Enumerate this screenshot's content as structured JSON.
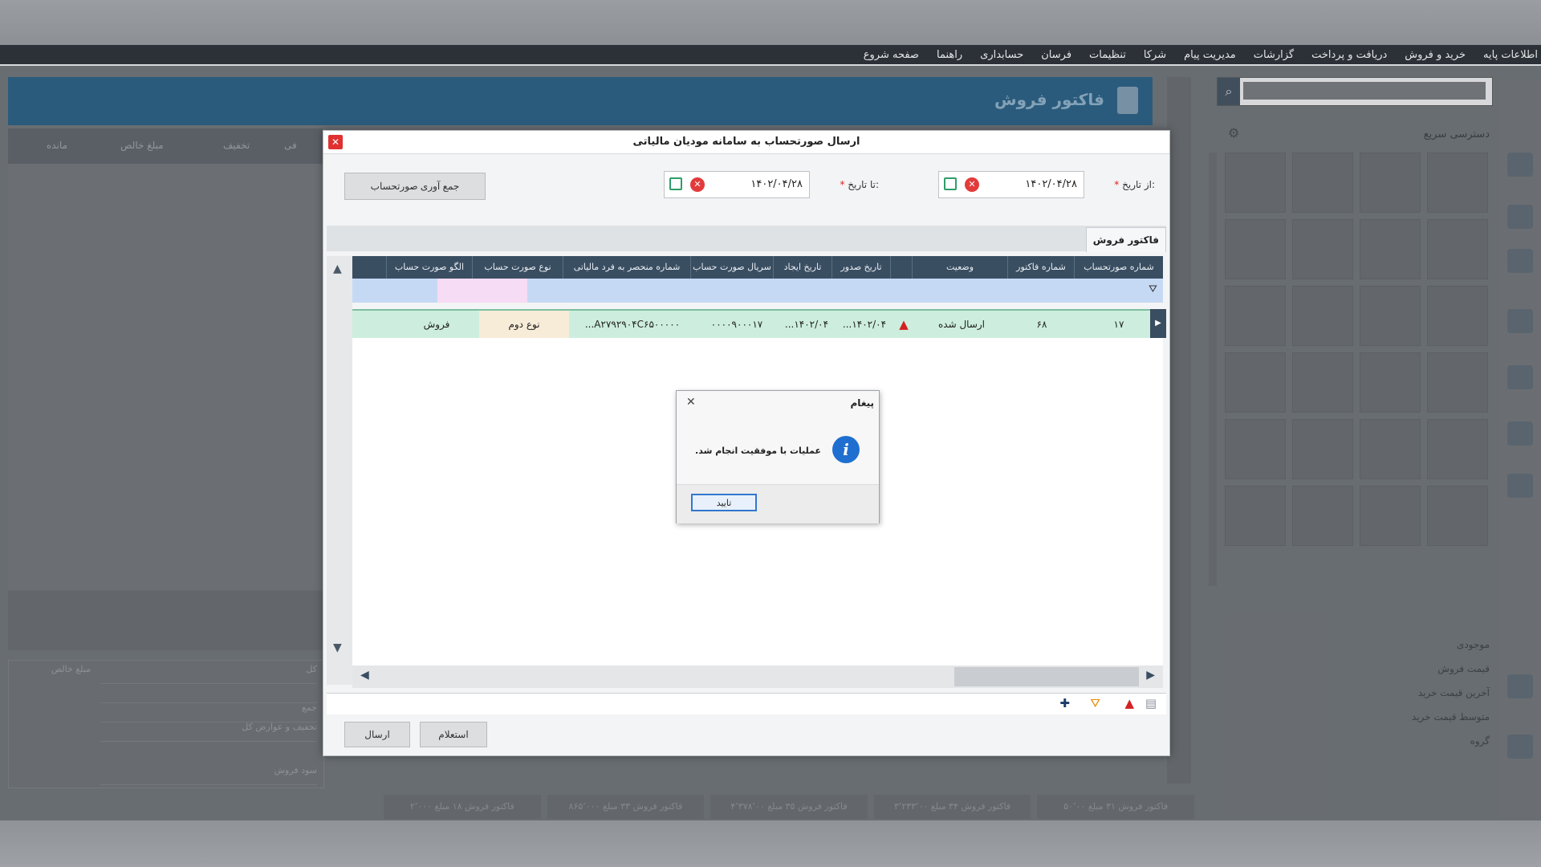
{
  "menu": [
    "اطلاعات پایه",
    "خرید و فروش",
    "دریافت و پرداخت",
    "گزارشات",
    "مدیریت پیام",
    "شرکا",
    "تنظیمات",
    "فرسان",
    "حسابداری",
    "راهنما",
    "صفحه شروع"
  ],
  "main": {
    "title": "فاکتور فروش",
    "columns": [
      "مبلغ خالص",
      "تخفیف",
      "فی",
      "مانده"
    ]
  },
  "left_summary": [
    "کل",
    "",
    "جمع",
    "تخفیف و عوارض کل",
    "سود فروش",
    "مبلغ خالص"
  ],
  "quick_access": {
    "title": "دسترسی سریع",
    "info": [
      "موجودی",
      "قیمت فروش",
      "آخرین قیمت خرید",
      "متوسط قیمت خرید",
      "گروه"
    ]
  },
  "taskbar": [
    "فاکتور فروش ۱۸ مبلغ ۲٬۰۰۰",
    "فاکتور فروش ۳۳ مبلغ ۸۶۵٬۰۰۰",
    "فاکتور فروش ۳۵ مبلغ ۴٬۳۷۸٬۰۰",
    "فاکتور فروش ۳۴ مبلغ ۳٬۲۳۳٬۰۰",
    "فاکتور فروش ۳۱ مبلغ ۵۰٬۰۰"
  ],
  "modal": {
    "title": "ارسال صورتحساب به سامانه مودیان مالیاتی",
    "from_label": "از تاریخ:",
    "from_value": "۱۴۰۲/۰۴/۲۸",
    "to_label": "تا تاریخ:",
    "to_value": "۱۴۰۲/۰۴/۲۸",
    "collect_btn": "جمع آوری صورتحساب",
    "tab": "فاکتور فروش",
    "columns": [
      "شماره صورتحساب",
      "شماره فاکتور",
      "وضعیت",
      "",
      "تاریخ صدور",
      "تاریخ ایجاد",
      "سریال صورت حساب",
      "شماره منحصر به فرد مالیاتی",
      "نوع صورت حساب",
      "الگو صورت حساب"
    ],
    "row": {
      "invoice_no": "۱۷",
      "factor_no": "۶۸",
      "status": "ارسال شده",
      "issue_date": "...۱۴۰۲/۰۴",
      "create_date": "...۱۴۰۲/۰۴",
      "serial": "۰۰۰۰۹۰۰۰۱۷",
      "tax_id": "...A۲۷۹۲۹۰۴C۶۵۰۰۰۰۰",
      "type": "نوع دوم",
      "pattern": "فروش"
    },
    "inquiry_btn": "استعلام",
    "send_btn": "ارسال"
  },
  "message": {
    "title": "پیغام",
    "text": "عملیات با موفقیت انجام شد.",
    "ok": "تایید"
  },
  "colors": {
    "header": "#0d4a73",
    "grid_head": "#3a4e62",
    "row": "#cdeede",
    "close": "#e03131",
    "info": "#1f6fd0"
  }
}
